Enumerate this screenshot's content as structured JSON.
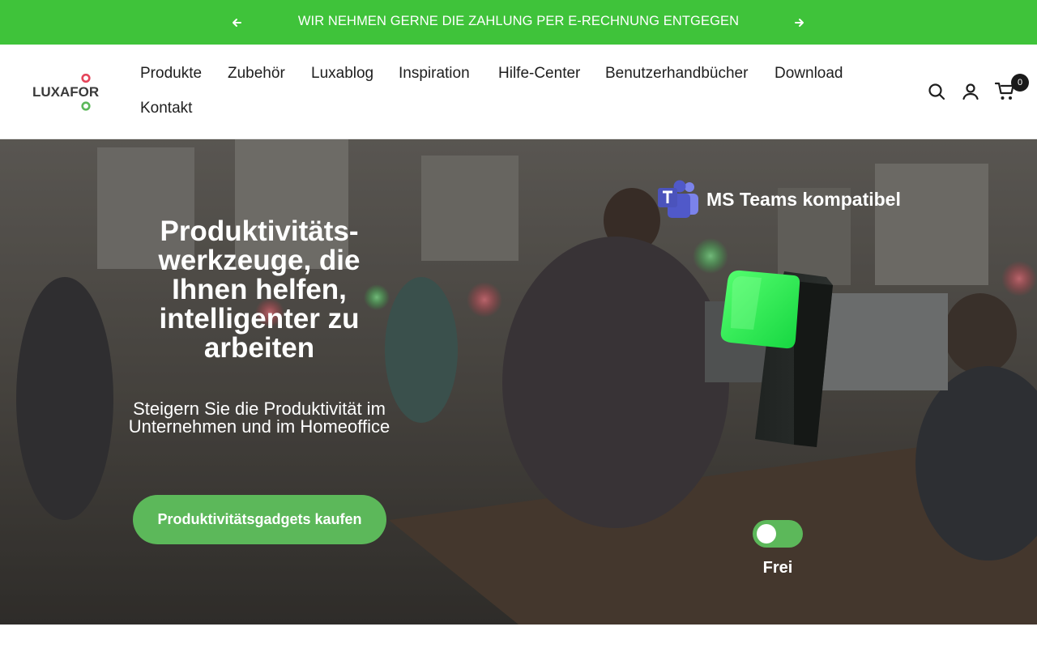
{
  "announcement": {
    "message": "WIR NEHMEN GERNE DIE ZAHLUNG PER E-RECHNUNG ENTGEGEN",
    "prev_icon": "arrow-left-icon",
    "next_icon": "arrow-right-icon",
    "background": "#3fc33a"
  },
  "header": {
    "logo_text": "LUXAFOR",
    "nav": [
      {
        "label": "Produkte"
      },
      {
        "label": "Zubehör"
      },
      {
        "label": "Luxablog"
      },
      {
        "label": "Inspiration"
      },
      {
        "label": "Hilfe-Center"
      },
      {
        "label": "Benutzerhandbücher"
      },
      {
        "label": "Download"
      },
      {
        "label": "Kontakt"
      }
    ],
    "icons": [
      "search-icon",
      "account-icon",
      "cart-icon"
    ],
    "cart_count": "0"
  },
  "hero": {
    "title": "Produktivitäts-werkzeuge, die Ihnen helfen, intelligenter zu arbeiten",
    "subtitle": "Steigern Sie die Produktivität im Unternehmen und im Homeoffice",
    "cta_label": "Produktivitätsgadgets kaufen",
    "teams_label": "MS Teams kompatibel",
    "toggle_label": "Frei",
    "toggle_on": true,
    "accent": "#5cb85a"
  }
}
